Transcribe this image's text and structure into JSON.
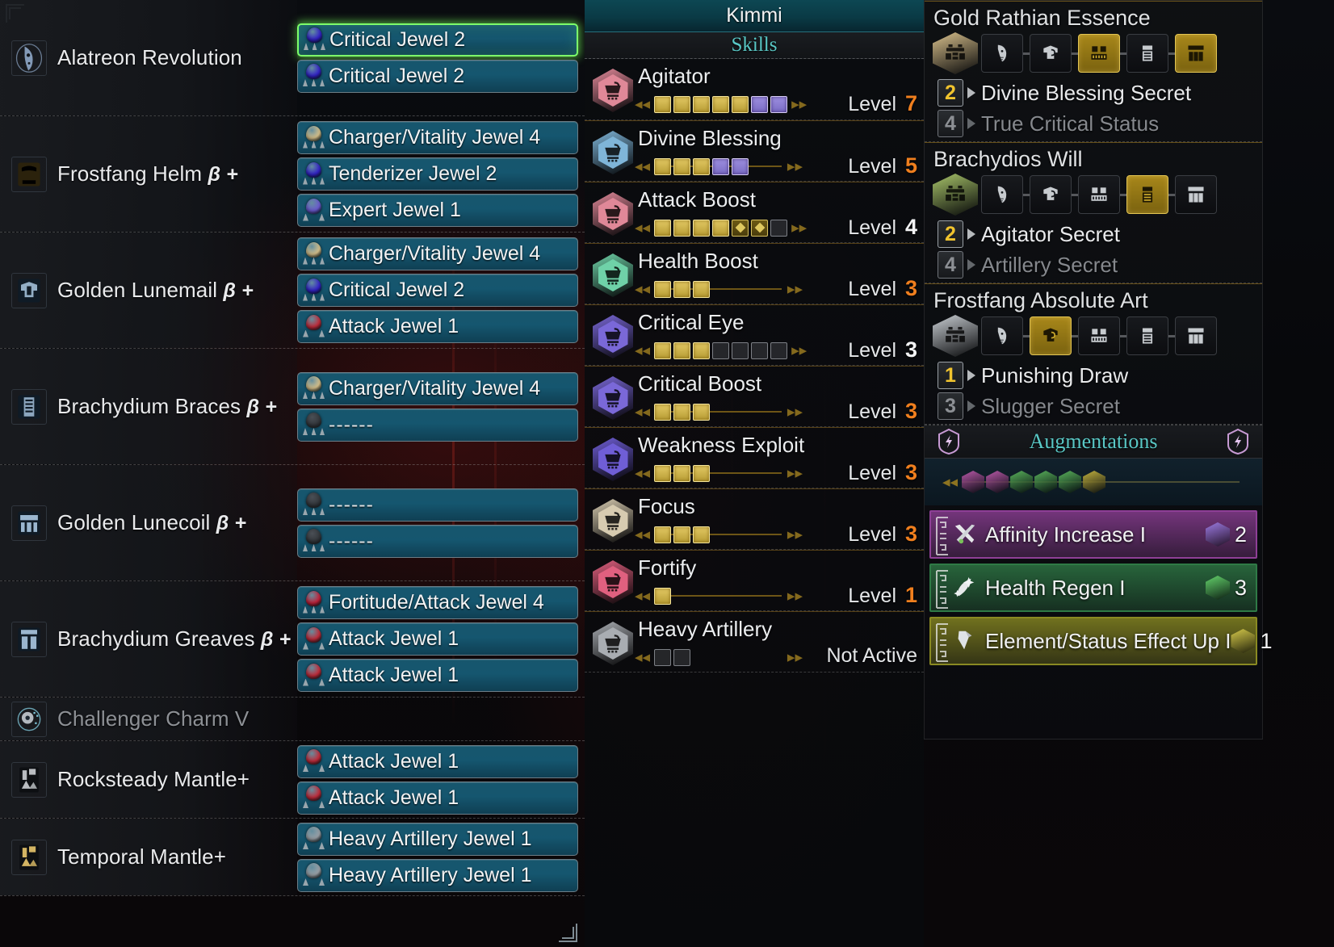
{
  "equipment": {
    "rows": [
      {
        "name": "Alatreon Revolution",
        "italic_suffix": "",
        "icon": "weapon-charge-blade-icon",
        "icon_color": "#8fa8c8",
        "dim": false,
        "slots": [
          {
            "label": "Critical Jewel 2",
            "gem_color": "#3322c8",
            "gem_size": 2,
            "selected": true,
            "empty": false
          },
          {
            "label": "Critical Jewel 2",
            "gem_color": "#3322c8",
            "gem_size": 2,
            "selected": false,
            "empty": false
          }
        ]
      },
      {
        "name": "Frostfang Helm",
        "italic_suffix": "β +",
        "icon": "armor-head-icon",
        "icon_color": "#c8a martyr",
        "dim": false,
        "slots": [
          {
            "label": "Charger/Vitality Jewel 4",
            "gem_color": "#d6c08a",
            "gem_size": 4,
            "selected": false,
            "empty": false
          },
          {
            "label": "Tenderizer Jewel 2",
            "gem_color": "#3322c8",
            "gem_size": 2,
            "selected": false,
            "empty": false
          },
          {
            "label": "Expert Jewel 1",
            "gem_color": "#6b5ad0",
            "gem_size": 1,
            "selected": false,
            "empty": false
          }
        ]
      },
      {
        "name": "Golden Lunemail",
        "italic_suffix": "β +",
        "icon": "armor-chest-icon",
        "icon_color": "#9ab6cf",
        "dim": false,
        "slots": [
          {
            "label": "Charger/Vitality Jewel 4",
            "gem_color": "#d6c08a",
            "gem_size": 4,
            "selected": false,
            "empty": false
          },
          {
            "label": "Critical Jewel 2",
            "gem_color": "#3322c8",
            "gem_size": 2,
            "selected": false,
            "empty": false
          },
          {
            "label": "Attack Jewel 1",
            "gem_color": "#c22b3a",
            "gem_size": 1,
            "selected": false,
            "empty": false
          }
        ]
      },
      {
        "name": "Brachydium Braces",
        "italic_suffix": "β +",
        "icon": "armor-arms-icon",
        "icon_color": "#9ab6cf",
        "dim": false,
        "slots": [
          {
            "label": "Charger/Vitality Jewel 4",
            "gem_color": "#d6c08a",
            "gem_size": 4,
            "selected": false,
            "empty": false
          },
          {
            "label": "------",
            "gem_color": "#2a2d31",
            "gem_size": 4,
            "selected": false,
            "empty": true
          }
        ]
      },
      {
        "name": "Golden Lunecoil",
        "italic_suffix": "β +",
        "icon": "armor-waist-icon",
        "icon_color": "#9ab6cf",
        "dim": false,
        "slots": [
          {
            "label": "------",
            "gem_color": "#2a2d31",
            "gem_size": 4,
            "selected": false,
            "empty": true
          },
          {
            "label": "------",
            "gem_color": "#2a2d31",
            "gem_size": 2,
            "selected": false,
            "empty": true
          }
        ]
      },
      {
        "name": "Brachydium Greaves",
        "italic_suffix": "β +",
        "icon": "armor-legs-icon",
        "icon_color": "#9ab6cf",
        "dim": false,
        "slots": [
          {
            "label": "Fortitude/Attack Jewel 4",
            "gem_color": "#c2213a",
            "gem_size": 4,
            "selected": false,
            "empty": false
          },
          {
            "label": "Attack Jewel 1",
            "gem_color": "#c22b3a",
            "gem_size": 1,
            "selected": false,
            "empty": false
          },
          {
            "label": "Attack Jewel 1",
            "gem_color": "#c22b3a",
            "gem_size": 1,
            "selected": false,
            "empty": false
          }
        ]
      },
      {
        "name": "Challenger Charm V",
        "italic_suffix": "",
        "icon": "charm-icon",
        "icon_color": "#7fc6d8",
        "dim": true,
        "slots": []
      },
      {
        "name": "Rocksteady Mantle+",
        "italic_suffix": "",
        "icon": "mantle-icon",
        "icon_color": "#b9bcc0",
        "dim": false,
        "slots": [
          {
            "label": "Attack Jewel 1",
            "gem_color": "#c22b3a",
            "gem_size": 1,
            "selected": false,
            "empty": false
          },
          {
            "label": "Attack Jewel 1",
            "gem_color": "#c22b3a",
            "gem_size": 1,
            "selected": false,
            "empty": false
          }
        ]
      },
      {
        "name": "Temporal Mantle+",
        "italic_suffix": "",
        "icon": "mantle-icon",
        "icon_color": "#d3b463",
        "dim": false,
        "slots": [
          {
            "label": "Heavy Artillery Jewel 1",
            "gem_color": "#9aa0a6",
            "gem_size": 1,
            "selected": false,
            "empty": false
          },
          {
            "label": "Heavy Artillery Jewel 1",
            "gem_color": "#9aa0a6",
            "gem_size": 1,
            "selected": false,
            "empty": false
          }
        ]
      }
    ]
  },
  "skills_panel": {
    "hunter_name": "Kimmi",
    "section_title": "Skills",
    "level_label": "Level",
    "not_active_label": "Not Active",
    "items": [
      {
        "name": "Agitator",
        "hex_color": "#e08898",
        "level": "7",
        "level_color": "orange",
        "active": true,
        "segments": [
          "gold",
          "gold",
          "gold",
          "gold",
          "gold",
          "purple",
          "purple"
        ],
        "track": false
      },
      {
        "name": "Divine Blessing",
        "hex_color": "#7fb5d8",
        "level": "5",
        "level_color": "orange",
        "active": true,
        "segments": [
          "gold",
          "gold",
          "gold",
          "purple",
          "purple"
        ],
        "track": true
      },
      {
        "name": "Attack Boost",
        "hex_color": "#e08898",
        "level": "4",
        "level_color": "white",
        "active": true,
        "segments": [
          "gold",
          "gold",
          "gold",
          "gold",
          "goldout",
          "goldout",
          "empty"
        ],
        "track": false
      },
      {
        "name": "Health Boost",
        "hex_color": "#6fd2a8",
        "level": "3",
        "level_color": "orange",
        "active": true,
        "segments": [
          "gold",
          "gold",
          "gold"
        ],
        "track": true
      },
      {
        "name": "Critical Eye",
        "hex_color": "#7a68d8",
        "level": "3",
        "level_color": "white",
        "active": true,
        "segments": [
          "gold",
          "gold",
          "gold",
          "empty",
          "empty",
          "empty",
          "empty"
        ],
        "track": false
      },
      {
        "name": "Critical Boost",
        "hex_color": "#7a68d8",
        "level": "3",
        "level_color": "orange",
        "active": true,
        "segments": [
          "gold",
          "gold",
          "gold"
        ],
        "track": true
      },
      {
        "name": "Weakness Exploit",
        "hex_color": "#6f5ed6",
        "level": "3",
        "level_color": "orange",
        "active": true,
        "segments": [
          "gold",
          "gold",
          "gold"
        ],
        "track": true
      },
      {
        "name": "Focus",
        "hex_color": "#d7cbb0",
        "level": "3",
        "level_color": "orange",
        "active": true,
        "segments": [
          "gold",
          "gold",
          "gold"
        ],
        "track": true
      },
      {
        "name": "Fortify",
        "hex_color": "#e0607f",
        "level": "1",
        "level_color": "orange",
        "active": true,
        "segments": [
          "gold"
        ],
        "track": true
      },
      {
        "name": "Heavy Artillery",
        "hex_color": "#a9adb2",
        "level": "",
        "level_color": "white",
        "active": false,
        "segments": [
          "empty",
          "empty"
        ],
        "track": false
      }
    ]
  },
  "bonuses_panel": {
    "augmentations_title": "Augmentations",
    "sets": [
      {
        "name": "Gold Rathian Essence",
        "hex_color": "#d8c08c",
        "pieces": [
          false,
          false,
          true,
          false,
          true
        ],
        "effects": [
          {
            "count": "2",
            "label": "Divine Blessing Secret",
            "active": true
          },
          {
            "count": "4",
            "label": "True Critical Status",
            "active": false
          }
        ]
      },
      {
        "name": "Brachydios Will",
        "hex_color": "#a8c46a",
        "pieces": [
          false,
          false,
          false,
          true,
          false
        ],
        "effects": [
          {
            "count": "2",
            "label": "Agitator Secret",
            "active": true
          },
          {
            "count": "4",
            "label": "Artillery Secret",
            "active": false
          }
        ]
      },
      {
        "name": "Frostfang Absolute Art",
        "hex_color": "#c9ced3",
        "pieces": [
          false,
          true,
          false,
          false,
          false
        ],
        "effects": [
          {
            "count": "1",
            "label": "Punishing Draw",
            "active": true
          },
          {
            "count": "3",
            "label": "Slugger Secret",
            "active": false
          }
        ]
      }
    ],
    "augment_slots": [
      "#b858a8",
      "#b858a8",
      "#58b05a",
      "#58b05a",
      "#58b05a",
      "#c2b13e"
    ],
    "augments": [
      {
        "label": "Affinity Increase I",
        "color": "#8e3f96",
        "icon": "affinity-icon",
        "cost": "2",
        "gem_color": "#9a7ae0"
      },
      {
        "label": "Health Regen I",
        "color": "#2f7a46",
        "icon": "health-regen-icon",
        "cost": "3",
        "gem_color": "#63d06a"
      },
      {
        "label": "Element/Status Effect Up I",
        "color": "#8a8a22",
        "icon": "element-up-icon",
        "cost": "1",
        "gem_color": "#d4c84a"
      }
    ]
  }
}
